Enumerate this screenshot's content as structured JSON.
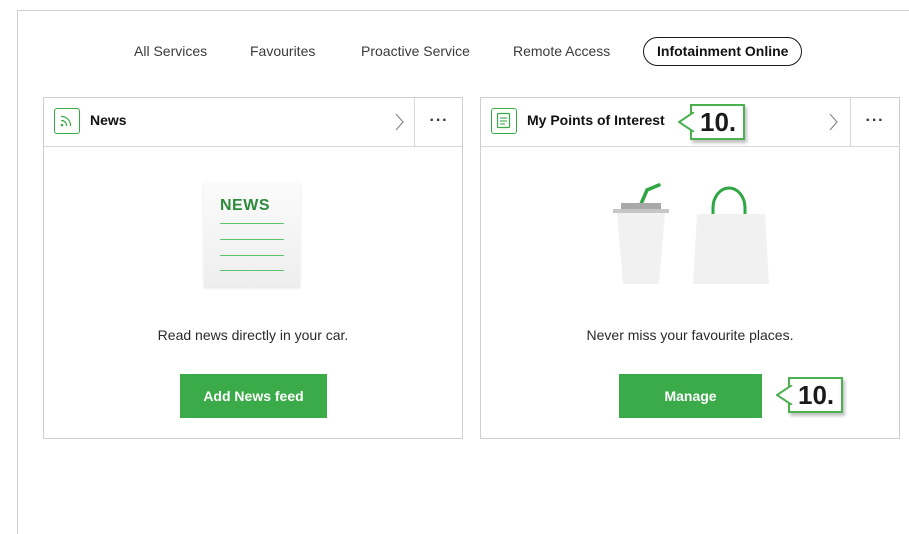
{
  "tabs": [
    {
      "label": "All Services",
      "active": false
    },
    {
      "label": "Favourites",
      "active": false
    },
    {
      "label": "Proactive Service",
      "active": false
    },
    {
      "label": "Remote Access",
      "active": false
    },
    {
      "label": "Infotainment Online",
      "active": true
    }
  ],
  "cards": [
    {
      "title": "News",
      "icon": "rss-feed-icon",
      "illustration_text": "NEWS",
      "description": "Read news directly in your car.",
      "button_label": "Add News feed"
    },
    {
      "title": "My Points of Interest",
      "icon": "document-list-icon",
      "description": "Never miss your favourite places.",
      "button_label": "Manage"
    }
  ],
  "callouts": [
    "10.",
    "10."
  ],
  "colors": {
    "accent": "#3bab49",
    "callout_border": "#4caf50",
    "text": "#1a1a1a",
    "border": "#cfcfcf"
  }
}
